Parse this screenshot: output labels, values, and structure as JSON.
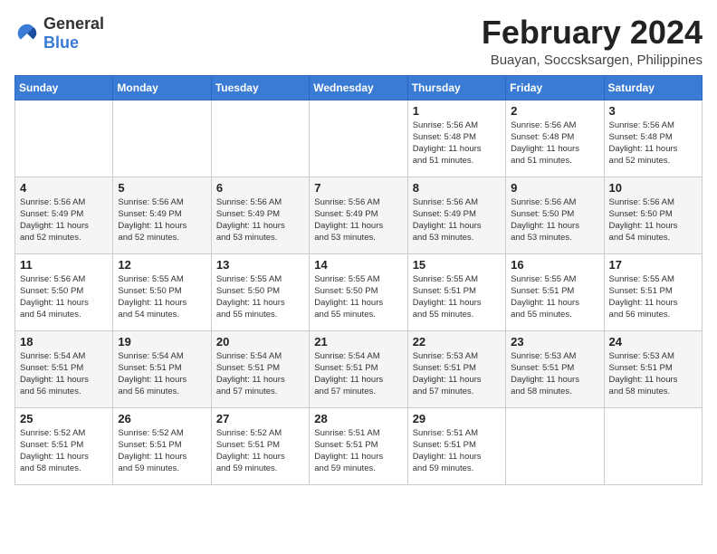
{
  "logo": {
    "text_general": "General",
    "text_blue": "Blue"
  },
  "title": "February 2024",
  "location": "Buayan, Soccsksargen, Philippines",
  "days_of_week": [
    "Sunday",
    "Monday",
    "Tuesday",
    "Wednesday",
    "Thursday",
    "Friday",
    "Saturday"
  ],
  "weeks": [
    [
      {
        "day": "",
        "info": ""
      },
      {
        "day": "",
        "info": ""
      },
      {
        "day": "",
        "info": ""
      },
      {
        "day": "",
        "info": ""
      },
      {
        "day": "1",
        "info": "Sunrise: 5:56 AM\nSunset: 5:48 PM\nDaylight: 11 hours\nand 51 minutes."
      },
      {
        "day": "2",
        "info": "Sunrise: 5:56 AM\nSunset: 5:48 PM\nDaylight: 11 hours\nand 51 minutes."
      },
      {
        "day": "3",
        "info": "Sunrise: 5:56 AM\nSunset: 5:48 PM\nDaylight: 11 hours\nand 52 minutes."
      }
    ],
    [
      {
        "day": "4",
        "info": "Sunrise: 5:56 AM\nSunset: 5:49 PM\nDaylight: 11 hours\nand 52 minutes."
      },
      {
        "day": "5",
        "info": "Sunrise: 5:56 AM\nSunset: 5:49 PM\nDaylight: 11 hours\nand 52 minutes."
      },
      {
        "day": "6",
        "info": "Sunrise: 5:56 AM\nSunset: 5:49 PM\nDaylight: 11 hours\nand 53 minutes."
      },
      {
        "day": "7",
        "info": "Sunrise: 5:56 AM\nSunset: 5:49 PM\nDaylight: 11 hours\nand 53 minutes."
      },
      {
        "day": "8",
        "info": "Sunrise: 5:56 AM\nSunset: 5:49 PM\nDaylight: 11 hours\nand 53 minutes."
      },
      {
        "day": "9",
        "info": "Sunrise: 5:56 AM\nSunset: 5:50 PM\nDaylight: 11 hours\nand 53 minutes."
      },
      {
        "day": "10",
        "info": "Sunrise: 5:56 AM\nSunset: 5:50 PM\nDaylight: 11 hours\nand 54 minutes."
      }
    ],
    [
      {
        "day": "11",
        "info": "Sunrise: 5:56 AM\nSunset: 5:50 PM\nDaylight: 11 hours\nand 54 minutes."
      },
      {
        "day": "12",
        "info": "Sunrise: 5:55 AM\nSunset: 5:50 PM\nDaylight: 11 hours\nand 54 minutes."
      },
      {
        "day": "13",
        "info": "Sunrise: 5:55 AM\nSunset: 5:50 PM\nDaylight: 11 hours\nand 55 minutes."
      },
      {
        "day": "14",
        "info": "Sunrise: 5:55 AM\nSunset: 5:50 PM\nDaylight: 11 hours\nand 55 minutes."
      },
      {
        "day": "15",
        "info": "Sunrise: 5:55 AM\nSunset: 5:51 PM\nDaylight: 11 hours\nand 55 minutes."
      },
      {
        "day": "16",
        "info": "Sunrise: 5:55 AM\nSunset: 5:51 PM\nDaylight: 11 hours\nand 55 minutes."
      },
      {
        "day": "17",
        "info": "Sunrise: 5:55 AM\nSunset: 5:51 PM\nDaylight: 11 hours\nand 56 minutes."
      }
    ],
    [
      {
        "day": "18",
        "info": "Sunrise: 5:54 AM\nSunset: 5:51 PM\nDaylight: 11 hours\nand 56 minutes."
      },
      {
        "day": "19",
        "info": "Sunrise: 5:54 AM\nSunset: 5:51 PM\nDaylight: 11 hours\nand 56 minutes."
      },
      {
        "day": "20",
        "info": "Sunrise: 5:54 AM\nSunset: 5:51 PM\nDaylight: 11 hours\nand 57 minutes."
      },
      {
        "day": "21",
        "info": "Sunrise: 5:54 AM\nSunset: 5:51 PM\nDaylight: 11 hours\nand 57 minutes."
      },
      {
        "day": "22",
        "info": "Sunrise: 5:53 AM\nSunset: 5:51 PM\nDaylight: 11 hours\nand 57 minutes."
      },
      {
        "day": "23",
        "info": "Sunrise: 5:53 AM\nSunset: 5:51 PM\nDaylight: 11 hours\nand 58 minutes."
      },
      {
        "day": "24",
        "info": "Sunrise: 5:53 AM\nSunset: 5:51 PM\nDaylight: 11 hours\nand 58 minutes."
      }
    ],
    [
      {
        "day": "25",
        "info": "Sunrise: 5:52 AM\nSunset: 5:51 PM\nDaylight: 11 hours\nand 58 minutes."
      },
      {
        "day": "26",
        "info": "Sunrise: 5:52 AM\nSunset: 5:51 PM\nDaylight: 11 hours\nand 59 minutes."
      },
      {
        "day": "27",
        "info": "Sunrise: 5:52 AM\nSunset: 5:51 PM\nDaylight: 11 hours\nand 59 minutes."
      },
      {
        "day": "28",
        "info": "Sunrise: 5:51 AM\nSunset: 5:51 PM\nDaylight: 11 hours\nand 59 minutes."
      },
      {
        "day": "29",
        "info": "Sunrise: 5:51 AM\nSunset: 5:51 PM\nDaylight: 11 hours\nand 59 minutes."
      },
      {
        "day": "",
        "info": ""
      },
      {
        "day": "",
        "info": ""
      }
    ]
  ]
}
